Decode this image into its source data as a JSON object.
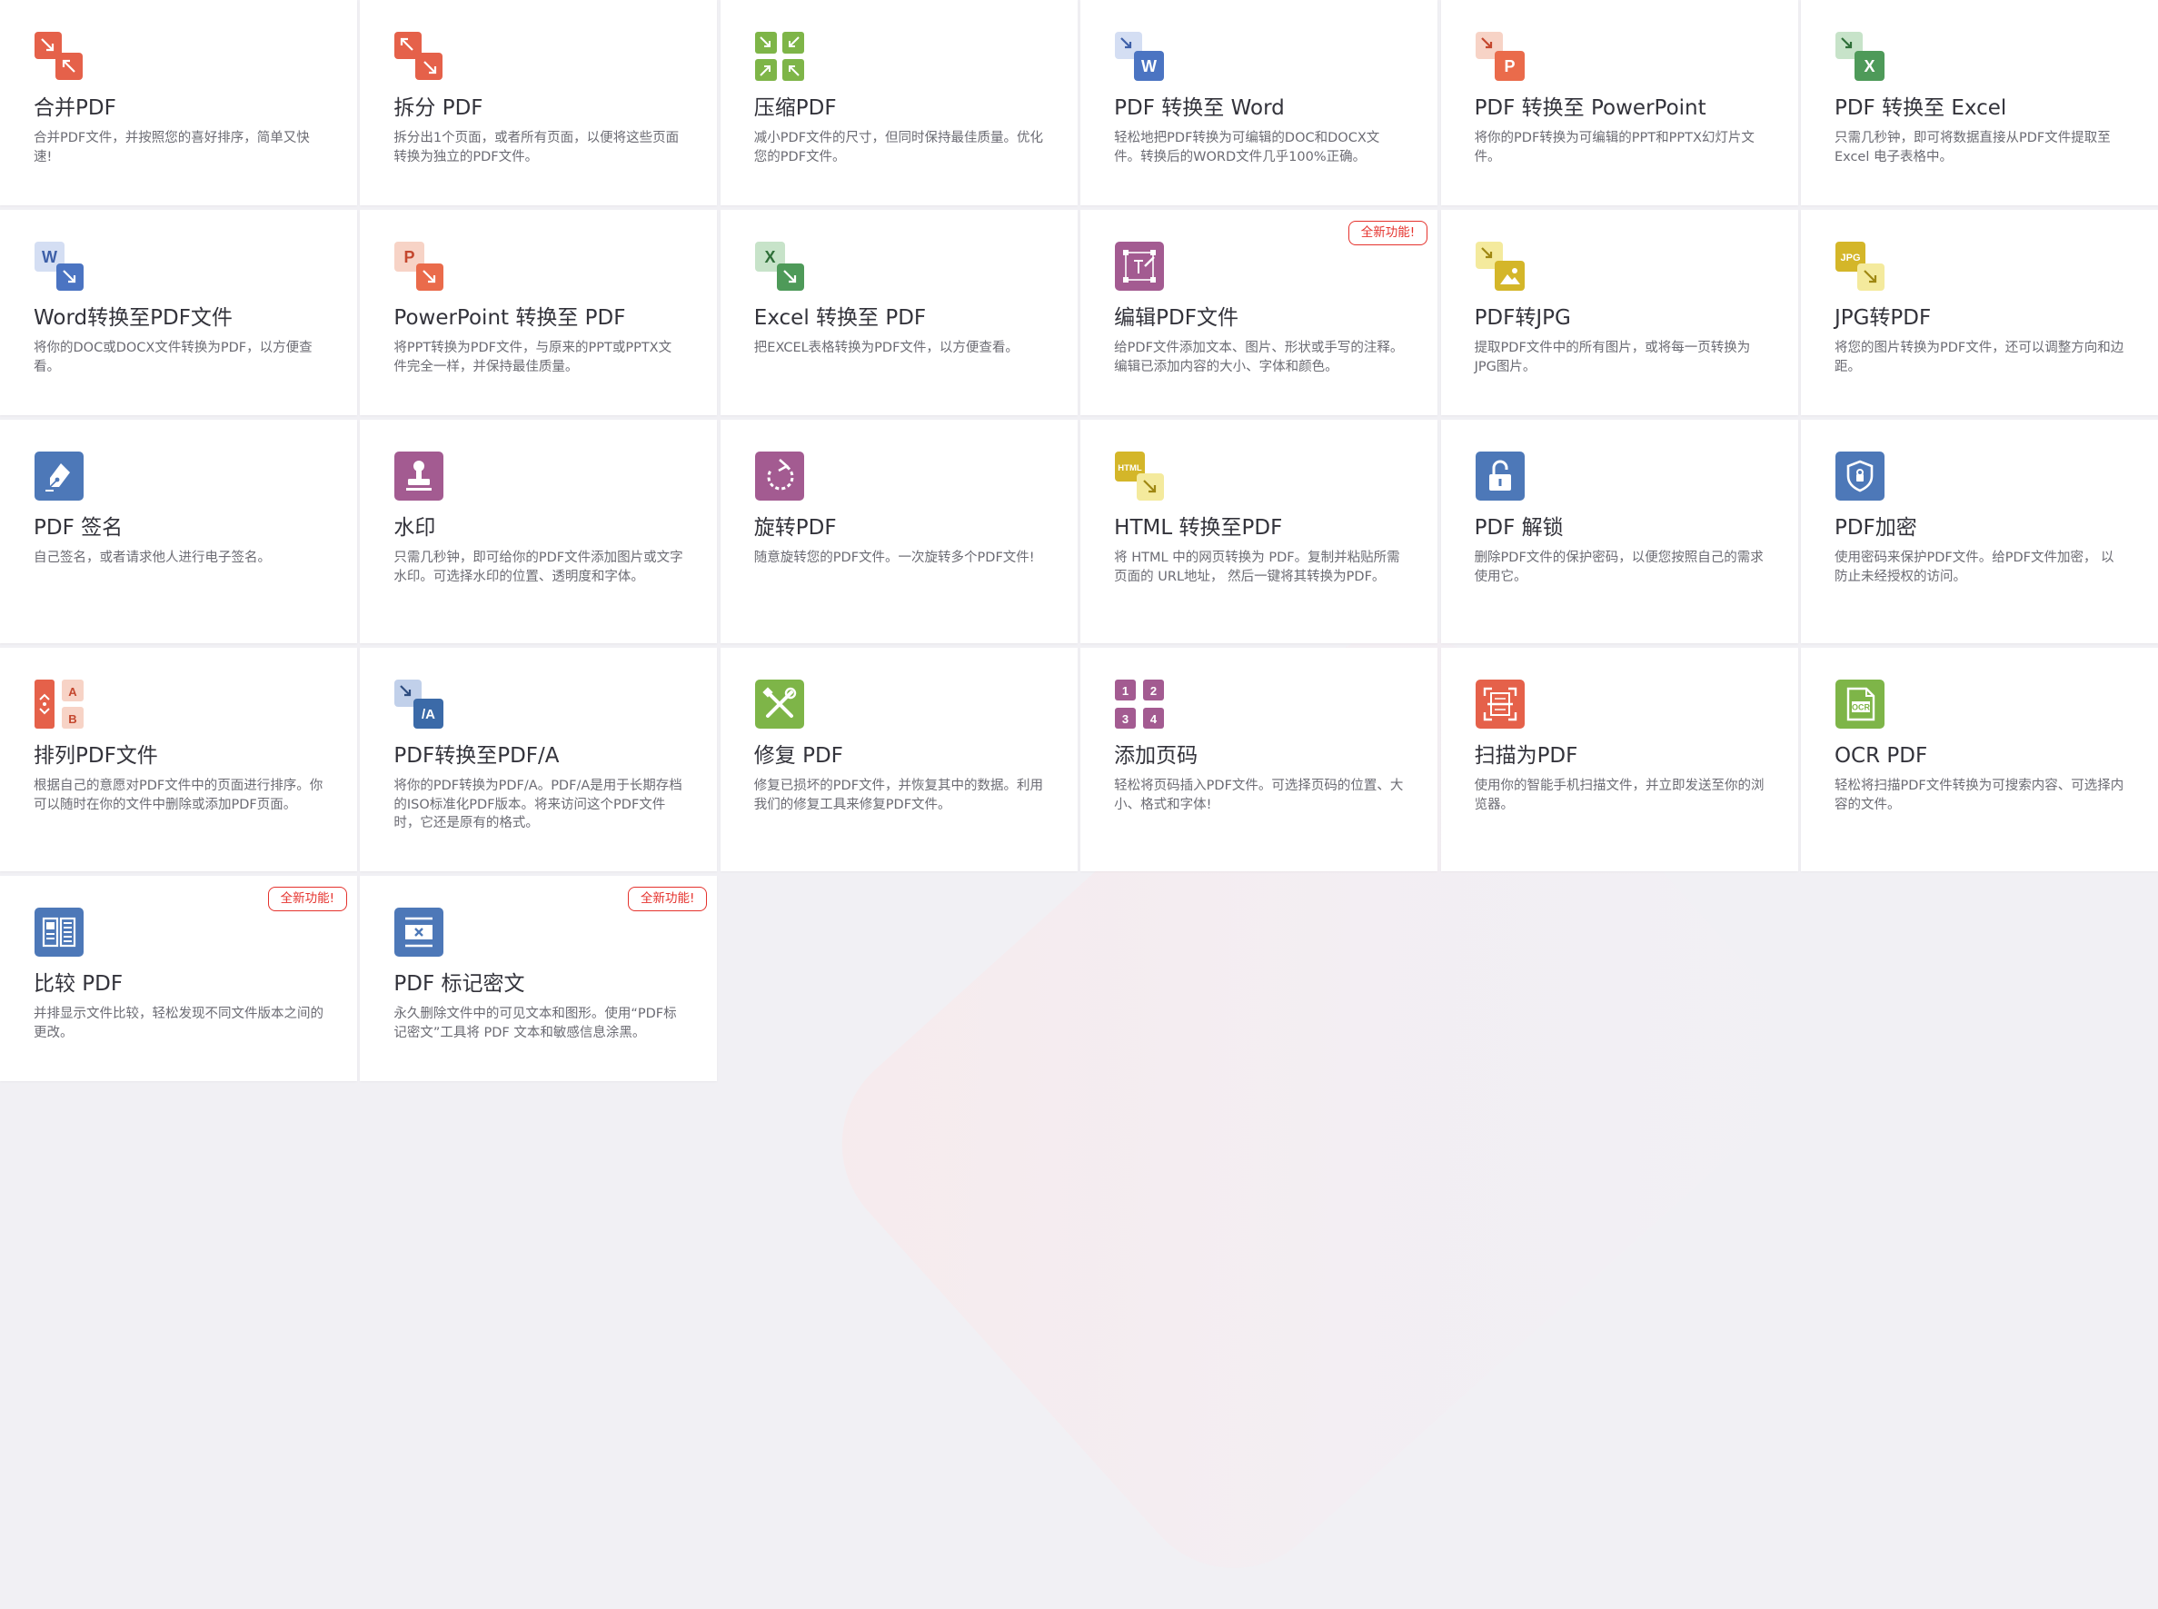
{
  "colors": {
    "red": "#e5614a",
    "green": "#7eb548",
    "blue": "#4d78b8",
    "word": "#4b74c2",
    "ppt": "#ea6b4b",
    "excel": "#4e9a59",
    "purple": "#a35b91",
    "yellow": "#d4b629",
    "badge": "#e5322d"
  },
  "badge_label": "全新功能!",
  "tools": [
    {
      "title": "合并PDF",
      "desc": "合并PDF文件，并按照您的喜好排序，简单又快速!",
      "icon": "merge-icon"
    },
    {
      "title": "拆分 PDF",
      "desc": "拆分出1个页面，或者所有页面，以便将这些页面转换为独立的PDF文件。",
      "icon": "split-icon"
    },
    {
      "title": "压缩PDF",
      "desc": "减小PDF文件的尺寸，但同时保持最佳质量。优化您的PDF文件。",
      "icon": "compress-icon"
    },
    {
      "title": "PDF 转换至 Word",
      "desc": "轻松地把PDF转换为可编辑的DOC和DOCX文件。转换后的WORD文件几乎100%正确。",
      "icon": "pdf-to-word-icon"
    },
    {
      "title": "PDF 转换至 PowerPoint",
      "desc": "将你的PDF转换为可编辑的PPT和PPTX幻灯片文件。",
      "icon": "pdf-to-powerpoint-icon"
    },
    {
      "title": "PDF 转换至 Excel",
      "desc": "只需几秒钟，即可将数据直接从PDF文件提取至Excel 电子表格中。",
      "icon": "pdf-to-excel-icon"
    },
    {
      "title": "Word转换至PDF文件",
      "desc": "将你的DOC或DOCX文件转换为PDF，以方便查看。",
      "icon": "word-to-pdf-icon"
    },
    {
      "title": "PowerPoint 转换至 PDF",
      "desc": "将PPT转换为PDF文件，与原来的PPT或PPTX文件完全一样，并保持最佳质量。",
      "icon": "powerpoint-to-pdf-icon"
    },
    {
      "title": "Excel 转换至 PDF",
      "desc": "把EXCEL表格转换为PDF文件，以方便查看。",
      "icon": "excel-to-pdf-icon"
    },
    {
      "title": "编辑PDF文件",
      "desc": "给PDF文件添加文本、图片、形状或手写的注释。编辑已添加内容的大小、字体和颜色。",
      "icon": "edit-pdf-icon",
      "badge": true
    },
    {
      "title": "PDF转JPG",
      "desc": "提取PDF文件中的所有图片，或将每一页转换为JPG图片。",
      "icon": "pdf-to-jpg-icon"
    },
    {
      "title": "JPG转PDF",
      "desc": "将您的图片转换为PDF文件，还可以调整方向和边距。",
      "icon": "jpg-to-pdf-icon"
    },
    {
      "title": "PDF 签名",
      "desc": "自己签名，或者请求他人进行电子签名。",
      "icon": "sign-icon"
    },
    {
      "title": "水印",
      "desc": "只需几秒钟，即可给你的PDF文件添加图片或文字水印。可选择水印的位置、透明度和字体。",
      "icon": "watermark-stamp-icon"
    },
    {
      "title": "旋转PDF",
      "desc": "随意旋转您的PDF文件。一次旋转多个PDF文件!",
      "icon": "rotate-icon"
    },
    {
      "title": "HTML 转换至PDF",
      "desc": "将 HTML 中的网页转换为 PDF。复制并粘贴所需页面的 URL地址， 然后一键将其转换为PDF。",
      "icon": "html-to-pdf-icon"
    },
    {
      "title": "PDF 解锁",
      "desc": "删除PDF文件的保护密码，以便您按照自己的需求使用它。",
      "icon": "unlock-icon"
    },
    {
      "title": "PDF加密",
      "desc": "使用密码来保护PDF文件。给PDF文件加密， 以防止未经授权的访问。",
      "icon": "protect-shield-icon"
    },
    {
      "title": "排列PDF文件",
      "desc": "根据自己的意愿对PDF文件中的页面进行排序。你可以随时在你的文件中删除或添加PDF页面。",
      "icon": "organize-icon"
    },
    {
      "title": "PDF转换至PDF/A",
      "desc": "将你的PDF转换为PDF/A。PDF/A是用于长期存档的ISO标准化PDF版本。将来访问这个PDF文件时，它还是原有的格式。",
      "icon": "pdf-to-pdfa-icon"
    },
    {
      "title": "修复 PDF",
      "desc": "修复已损坏的PDF文件，并恢复其中的数据。利用我们的修复工具来修复PDF文件。",
      "icon": "repair-tools-icon"
    },
    {
      "title": "添加页码",
      "desc": "轻松将页码插入PDF文件。可选择页码的位置、大小、格式和字体!",
      "icon": "page-numbers-icon"
    },
    {
      "title": "扫描为PDF",
      "desc": "使用你的智能手机扫描文件，并立即发送至你的浏览器。",
      "icon": "scan-icon"
    },
    {
      "title": "OCR PDF",
      "desc": "轻松将扫描PDF文件转换为可搜索内容、可选择内容的文件。",
      "icon": "ocr-icon"
    },
    {
      "title": "比较 PDF",
      "desc": "并排显示文件比较，轻松发现不同文件版本之间的更改。",
      "icon": "compare-icon",
      "badge": true
    },
    {
      "title": "PDF 标记密文",
      "desc": "永久删除文件中的可见文本和图形。使用“PDF标记密文”工具将 PDF 文本和敏感信息涂黑。",
      "icon": "redact-icon",
      "badge": true
    }
  ]
}
